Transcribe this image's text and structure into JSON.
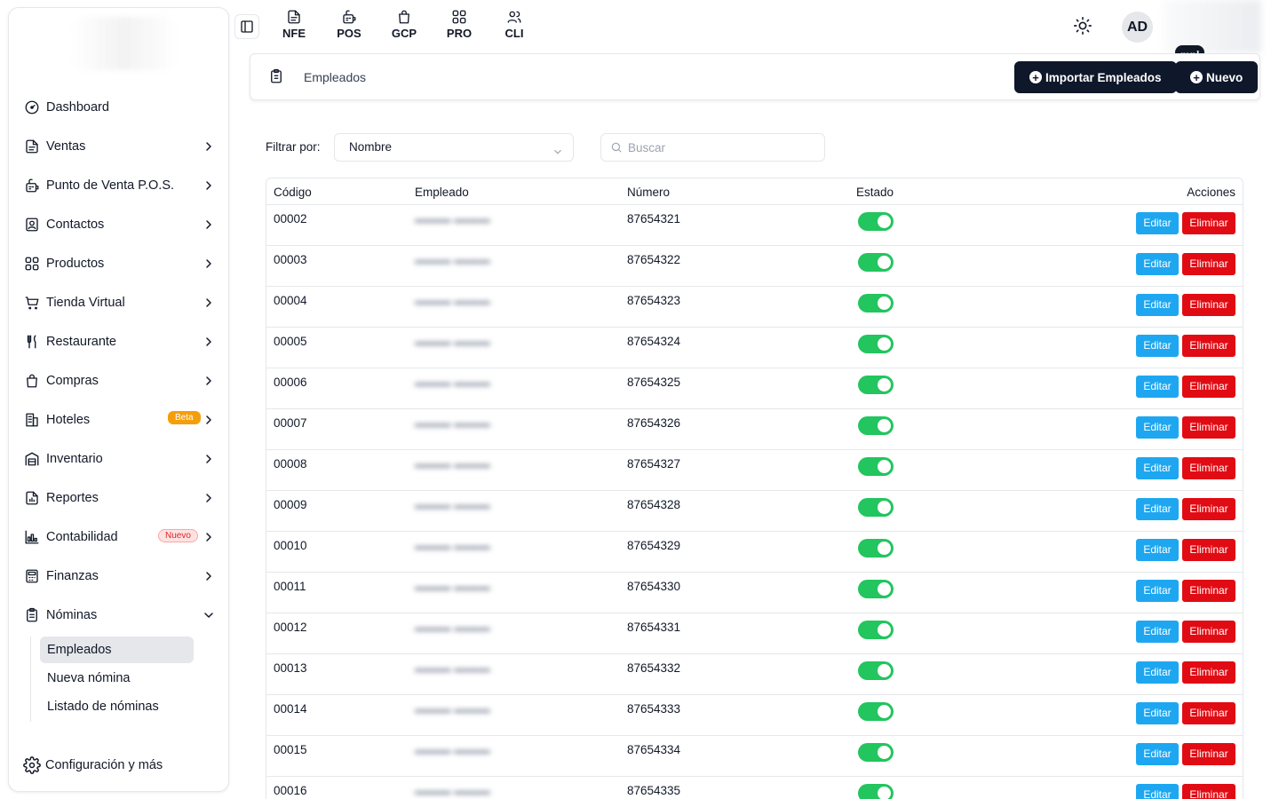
{
  "sidebar": {
    "items": [
      {
        "label": "Dashboard",
        "icon": "gauge-icon",
        "chevron": false
      },
      {
        "label": "Ventas",
        "icon": "document-icon",
        "chevron": true
      },
      {
        "label": "Punto de Venta P.O.S.",
        "icon": "pos-icon",
        "chevron": true
      },
      {
        "label": "Contactos",
        "icon": "contacts-icon",
        "chevron": true
      },
      {
        "label": "Productos",
        "icon": "grid-icon",
        "chevron": true
      },
      {
        "label": "Tienda Virtual",
        "icon": "cart-icon",
        "chevron": true
      },
      {
        "label": "Restaurante",
        "icon": "utensils-icon",
        "chevron": true
      },
      {
        "label": "Compras",
        "icon": "shopping-bag-icon",
        "chevron": true
      },
      {
        "label": "Hoteles",
        "icon": "building-icon",
        "chevron": true,
        "badge": "Beta"
      },
      {
        "label": "Inventario",
        "icon": "warehouse-icon",
        "chevron": true
      },
      {
        "label": "Reportes",
        "icon": "report-icon",
        "chevron": true
      },
      {
        "label": "Contabilidad",
        "icon": "chart-icon",
        "chevron": true,
        "badge": "Nuevo"
      },
      {
        "label": "Finanzas",
        "icon": "calculator-icon",
        "chevron": true
      },
      {
        "label": "Nóminas",
        "icon": "clipboard-icon",
        "chevron": "down"
      }
    ],
    "sub_items": [
      {
        "label": "Empleados",
        "active": true
      },
      {
        "label": "Nueva nómina",
        "active": false
      },
      {
        "label": "Listado de nóminas",
        "active": false
      }
    ],
    "config_label": "Configuración y más"
  },
  "topbar": {
    "apps": [
      {
        "label": "NFE",
        "icon": "document-icon"
      },
      {
        "label": "POS",
        "icon": "pos-icon"
      },
      {
        "label": "GCP",
        "icon": "shopping-bag-icon"
      },
      {
        "label": "PRO",
        "icon": "grid-icon"
      },
      {
        "label": "CLI",
        "icon": "users-icon"
      }
    ],
    "avatar": "AD",
    "tooltip": "mpl"
  },
  "header": {
    "title": "Empleados",
    "import_button": "Importar Empleados",
    "new_button": "Nuevo"
  },
  "filters": {
    "label": "Filtrar por:",
    "selected": "Nombre",
    "search_placeholder": "Buscar"
  },
  "table": {
    "columns": [
      "Código",
      "Empleado",
      "Número",
      "Estado",
      "Acciones"
    ],
    "edit_label": "Editar",
    "delete_label": "Eliminar",
    "rows": [
      {
        "code": "00002",
        "number": "87654321",
        "active": true
      },
      {
        "code": "00003",
        "number": "87654322",
        "active": true
      },
      {
        "code": "00004",
        "number": "87654323",
        "active": true
      },
      {
        "code": "00005",
        "number": "87654324",
        "active": true
      },
      {
        "code": "00006",
        "number": "87654325",
        "active": true
      },
      {
        "code": "00007",
        "number": "87654326",
        "active": true
      },
      {
        "code": "00008",
        "number": "87654327",
        "active": true
      },
      {
        "code": "00009",
        "number": "87654328",
        "active": true
      },
      {
        "code": "00010",
        "number": "87654329",
        "active": true
      },
      {
        "code": "00011",
        "number": "87654330",
        "active": true
      },
      {
        "code": "00012",
        "number": "87654331",
        "active": true
      },
      {
        "code": "00013",
        "number": "87654332",
        "active": true
      },
      {
        "code": "00014",
        "number": "87654333",
        "active": true
      },
      {
        "code": "00015",
        "number": "87654334",
        "active": true
      },
      {
        "code": "00016",
        "number": "87654335",
        "active": true
      }
    ]
  },
  "colors": {
    "dark_button": "#0f172a",
    "edit_button": "#1ea7f0",
    "delete_button": "#e10b14",
    "switch_on": "#22c55e",
    "beta_badge": "#f59e0b",
    "nuevo_badge": "#dc2626"
  }
}
